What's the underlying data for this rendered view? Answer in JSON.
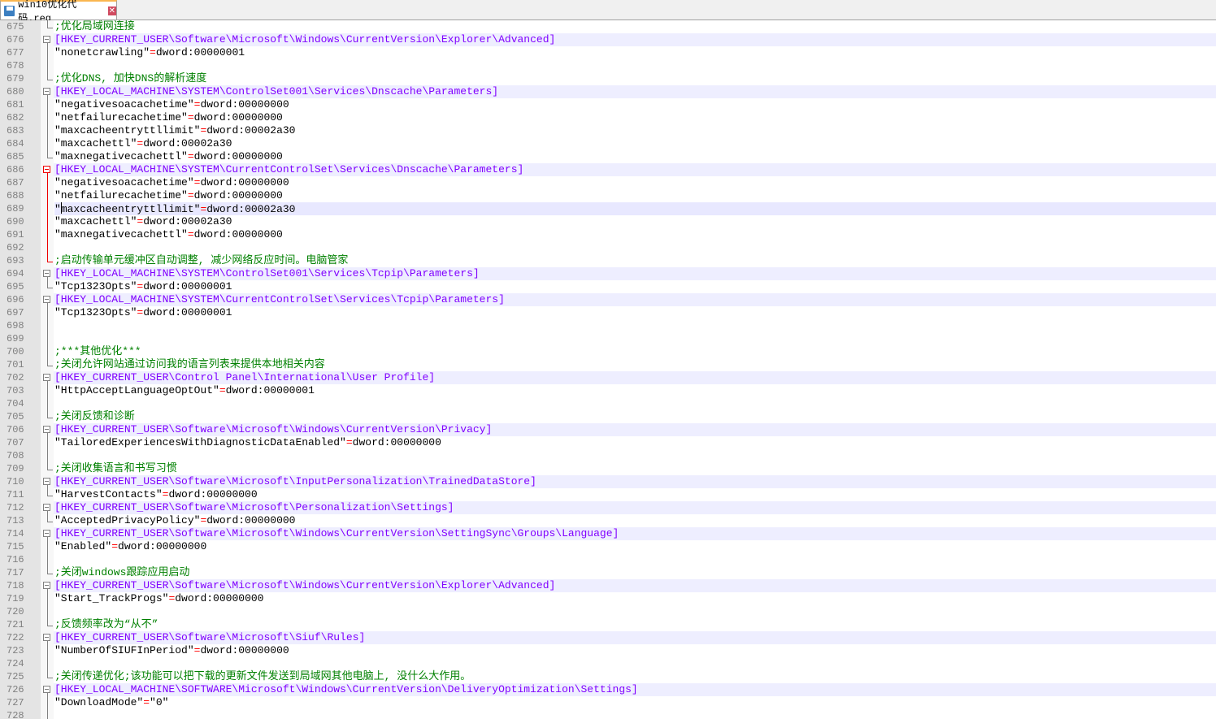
{
  "tab": {
    "title": "win10优化代码.reg",
    "close": "✕"
  },
  "assign_op": "=",
  "colors": {
    "key": "#8000ff",
    "comment": "#008000",
    "operator": "#ff0000",
    "line_number": "#808080"
  },
  "current_line": 689,
  "lines": [
    {
      "n": "675",
      "type": "comment",
      "text": ";优化局域网连接",
      "fold": "end"
    },
    {
      "n": "676",
      "type": "key",
      "text": "[HKEY_CURRENT_USER\\Software\\Microsoft\\Windows\\CurrentVersion\\Explorer\\Advanced]",
      "fold": "box"
    },
    {
      "n": "677",
      "type": "value",
      "name": "\"nonetcrawling\"",
      "value": "dword:00000001",
      "fold": "line"
    },
    {
      "n": "678",
      "type": "blank",
      "fold": "line"
    },
    {
      "n": "679",
      "type": "comment",
      "text": ";优化DNS, 加快DNS的解析速度",
      "fold": "end"
    },
    {
      "n": "680",
      "type": "key",
      "text": "[HKEY_LOCAL_MACHINE\\SYSTEM\\ControlSet001\\Services\\Dnscache\\Parameters]",
      "fold": "box"
    },
    {
      "n": "681",
      "type": "value",
      "name": "\"negativesoacachetime\"",
      "value": "dword:00000000",
      "fold": "line"
    },
    {
      "n": "682",
      "type": "value",
      "name": "\"netfailurecachetime\"",
      "value": "dword:00000000",
      "fold": "line"
    },
    {
      "n": "683",
      "type": "value",
      "name": "\"maxcacheentryttllimit\"",
      "value": "dword:00002a30",
      "fold": "line"
    },
    {
      "n": "684",
      "type": "value",
      "name": "\"maxcachettl\"",
      "value": "dword:00002a30",
      "fold": "line"
    },
    {
      "n": "685",
      "type": "value",
      "name": "\"maxnegativecachettl\"",
      "value": "dword:00000000",
      "fold": "end"
    },
    {
      "n": "686",
      "type": "key",
      "text": "[HKEY_LOCAL_MACHINE\\SYSTEM\\CurrentControlSet\\Services\\Dnscache\\Parameters]",
      "fold": "box",
      "red": true
    },
    {
      "n": "687",
      "type": "value",
      "name": "\"negativesoacachetime\"",
      "value": "dword:00000000",
      "fold": "line",
      "red": true
    },
    {
      "n": "688",
      "type": "value",
      "name": "\"netfailurecachetime\"",
      "value": "dword:00000000",
      "fold": "line",
      "red": true
    },
    {
      "n": "689",
      "type": "value",
      "name": "\"maxcacheentryttllimit\"",
      "value": "dword:00002a30",
      "fold": "line",
      "red": true
    },
    {
      "n": "690",
      "type": "value",
      "name": "\"maxcachettl\"",
      "value": "dword:00002a30",
      "fold": "line",
      "red": true
    },
    {
      "n": "691",
      "type": "value",
      "name": "\"maxnegativecachettl\"",
      "value": "dword:00000000",
      "fold": "line",
      "red": true
    },
    {
      "n": "692",
      "type": "blank",
      "fold": "line",
      "red": true
    },
    {
      "n": "693",
      "type": "comment",
      "text": ";启动传输单元缓冲区自动调整, 减少网络反应时间。电脑管家",
      "fold": "end",
      "red": true
    },
    {
      "n": "694",
      "type": "key",
      "text": "[HKEY_LOCAL_MACHINE\\SYSTEM\\ControlSet001\\Services\\Tcpip\\Parameters]",
      "fold": "box"
    },
    {
      "n": "695",
      "type": "value",
      "name": "\"Tcp1323Opts\"",
      "value": "dword:00000001",
      "fold": "end"
    },
    {
      "n": "696",
      "type": "key",
      "text": "[HKEY_LOCAL_MACHINE\\SYSTEM\\CurrentControlSet\\Services\\Tcpip\\Parameters]",
      "fold": "box"
    },
    {
      "n": "697",
      "type": "value",
      "name": "\"Tcp1323Opts\"",
      "value": "dword:00000001",
      "fold": "line"
    },
    {
      "n": "698",
      "type": "blank",
      "fold": "line"
    },
    {
      "n": "699",
      "type": "blank",
      "fold": "line"
    },
    {
      "n": "700",
      "type": "comment",
      "text": ";***其他优化***",
      "fold": "line"
    },
    {
      "n": "701",
      "type": "comment",
      "text": ";关闭允许网站通过访问我的语言列表来提供本地相关内容",
      "fold": "end"
    },
    {
      "n": "702",
      "type": "key",
      "text": "[HKEY_CURRENT_USER\\Control Panel\\International\\User Profile]",
      "fold": "box"
    },
    {
      "n": "703",
      "type": "value",
      "name": "\"HttpAcceptLanguageOptOut\"",
      "value": "dword:00000001",
      "fold": "line"
    },
    {
      "n": "704",
      "type": "blank",
      "fold": "line"
    },
    {
      "n": "705",
      "type": "comment",
      "text": ";关闭反馈和诊断",
      "fold": "end"
    },
    {
      "n": "706",
      "type": "key",
      "text": "[HKEY_CURRENT_USER\\Software\\Microsoft\\Windows\\CurrentVersion\\Privacy]",
      "fold": "box"
    },
    {
      "n": "707",
      "type": "value",
      "name": "\"TailoredExperiencesWithDiagnosticDataEnabled\"",
      "value": "dword:00000000",
      "fold": "line"
    },
    {
      "n": "708",
      "type": "blank",
      "fold": "line"
    },
    {
      "n": "709",
      "type": "comment",
      "text": ";关闭收集语言和书写习惯",
      "fold": "end"
    },
    {
      "n": "710",
      "type": "key",
      "text": "[HKEY_CURRENT_USER\\Software\\Microsoft\\InputPersonalization\\TrainedDataStore]",
      "fold": "box"
    },
    {
      "n": "711",
      "type": "value",
      "name": "\"HarvestContacts\"",
      "value": "dword:00000000",
      "fold": "end"
    },
    {
      "n": "712",
      "type": "key",
      "text": "[HKEY_CURRENT_USER\\Software\\Microsoft\\Personalization\\Settings]",
      "fold": "box"
    },
    {
      "n": "713",
      "type": "value",
      "name": "\"AcceptedPrivacyPolicy\"",
      "value": "dword:00000000",
      "fold": "end"
    },
    {
      "n": "714",
      "type": "key",
      "text": "[HKEY_CURRENT_USER\\Software\\Microsoft\\Windows\\CurrentVersion\\SettingSync\\Groups\\Language]",
      "fold": "box"
    },
    {
      "n": "715",
      "type": "value",
      "name": "\"Enabled\"",
      "value": "dword:00000000",
      "fold": "line"
    },
    {
      "n": "716",
      "type": "blank",
      "fold": "line"
    },
    {
      "n": "717",
      "type": "comment",
      "text": ";关闭windows跟踪应用启动",
      "fold": "end"
    },
    {
      "n": "718",
      "type": "key",
      "text": "[HKEY_CURRENT_USER\\Software\\Microsoft\\Windows\\CurrentVersion\\Explorer\\Advanced]",
      "fold": "box"
    },
    {
      "n": "719",
      "type": "value",
      "name": "\"Start_TrackProgs\"",
      "value": "dword:00000000",
      "fold": "line"
    },
    {
      "n": "720",
      "type": "blank",
      "fold": "line"
    },
    {
      "n": "721",
      "type": "comment",
      "text": ";反馈频率改为“从不”",
      "fold": "end"
    },
    {
      "n": "722",
      "type": "key",
      "text": "[HKEY_CURRENT_USER\\Software\\Microsoft\\Siuf\\Rules]",
      "fold": "box"
    },
    {
      "n": "723",
      "type": "value",
      "name": "\"NumberOfSIUFInPeriod\"",
      "value": "dword:00000000",
      "fold": "line"
    },
    {
      "n": "724",
      "type": "blank",
      "fold": "line"
    },
    {
      "n": "725",
      "type": "comment",
      "text": ";关闭传递优化;该功能可以把下载的更新文件发送到局域网其他电脑上, 没什么大作用。",
      "fold": "end"
    },
    {
      "n": "726",
      "type": "key",
      "text": "[HKEY_LOCAL_MACHINE\\SOFTWARE\\Microsoft\\Windows\\CurrentVersion\\DeliveryOptimization\\Settings]",
      "fold": "box"
    },
    {
      "n": "727",
      "type": "value",
      "name": "\"DownloadMode\"",
      "value": "\"0\"",
      "fold": "line"
    },
    {
      "n": "728",
      "type": "blank",
      "fold": "line"
    }
  ]
}
